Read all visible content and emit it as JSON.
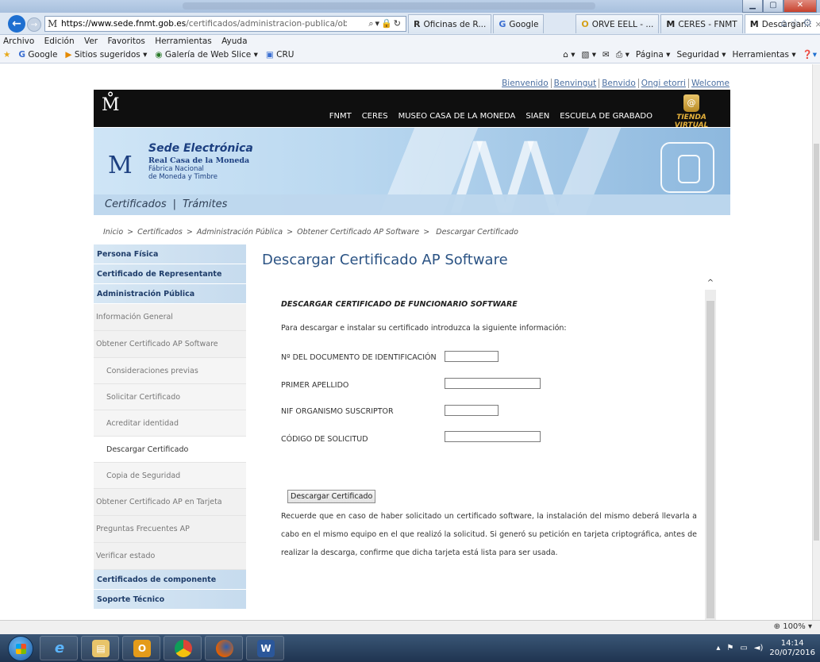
{
  "browser": {
    "address": {
      "url_host": "https://www.sede.fnmt.gob.es",
      "url_path": "/certificados/administracion-publica/obtener-certificado-",
      "favicon": "fnmt-crest-icon"
    },
    "tabs": [
      {
        "label": "Oficinas de R...",
        "icon": "R"
      },
      {
        "label": "Google",
        "icon": "G"
      },
      {
        "label": "ORVE EELL - ...",
        "icon": "O"
      },
      {
        "label": "CERES - FNMT",
        "icon": "M"
      },
      {
        "label": "Descargar...",
        "icon": "M",
        "active": true
      }
    ],
    "tab_close": "×",
    "menu": [
      "Archivo",
      "Edición",
      "Ver",
      "Favoritos",
      "Herramientas",
      "Ayuda"
    ],
    "favorites": [
      "Google",
      "Sitios sugeridos ▾",
      "Galería de Web Slice ▾",
      "CRU"
    ],
    "toolbar_right": [
      "Página ▾",
      "Seguridad ▾",
      "Herramientas ▾"
    ],
    "zoom": "100%"
  },
  "site": {
    "languages": [
      "Bienvenido",
      "Benvingut",
      "Benvido",
      "Ongi etorri",
      "Welcome"
    ],
    "crest": "M̊",
    "topnav": [
      "FNMT",
      "CERES",
      "MUSEO CASA DE LA MONEDA",
      "SIAEN",
      "ESCUELA DE GRABADO"
    ],
    "shop_label": "TIENDA VIRTUAL",
    "brand": {
      "title": "Sede Electrónica",
      "line1": "Real Casa de la Moneda",
      "line2": "Fábrica Nacional",
      "line3": "de Moneda y Timbre"
    },
    "subnav": [
      "Certificados",
      "Trámites"
    ],
    "breadcrumb": [
      "Inicio",
      "Certificados",
      "Administración Pública",
      "Obtener Certificado AP Software",
      "Descargar Certificado"
    ]
  },
  "sidebar": {
    "items": [
      {
        "label": "Persona Física",
        "kind": "cat"
      },
      {
        "label": "Certificado de Representante",
        "kind": "cat"
      },
      {
        "label": "Administración Pública",
        "kind": "cat"
      },
      {
        "label": "Información General",
        "kind": "sub"
      },
      {
        "label": "Obtener Certificado AP Software",
        "kind": "sub"
      },
      {
        "label": "Consideraciones previas",
        "kind": "sub2"
      },
      {
        "label": "Solicitar Certificado",
        "kind": "sub2"
      },
      {
        "label": "Acreditar identidad",
        "kind": "sub2"
      },
      {
        "label": "Descargar Certificado",
        "kind": "sub2",
        "current": true
      },
      {
        "label": "Copia de Seguridad",
        "kind": "sub2"
      },
      {
        "label": "Obtener Certificado AP en Tarjeta",
        "kind": "sub"
      },
      {
        "label": "Preguntas Frecuentes AP",
        "kind": "sub"
      },
      {
        "label": "Verificar estado",
        "kind": "sub"
      },
      {
        "label": "Certificados de componente",
        "kind": "cat"
      },
      {
        "label": "Soporte Técnico",
        "kind": "cat"
      }
    ]
  },
  "main": {
    "title": "Descargar Certificado AP Software",
    "heading": "DESCARGAR CERTIFICADO DE FUNCIONARIO SOFTWARE",
    "intro": "Para descargar e instalar su certificado introduzca la siguiente información:",
    "fields": {
      "doc_label": "Nº DEL DOCUMENTO DE IDENTIFICACIÓN",
      "doc_value": "",
      "surname_label": "PRIMER APELLIDO",
      "surname_value": "",
      "nif_label": "NIF ORGANISMO SUSCRIPTOR",
      "nif_value": "",
      "code_label": "CÓDIGO DE SOLICITUD",
      "code_value": ""
    },
    "button": "Descargar Certificado",
    "notice": "Recuerde que en caso de haber solicitado un certificado software, la instalación del mismo deberá llevarla a cabo en el mismo equipo en el que realizó la solicitud. Si generó su petición en tarjeta criptográfica, antes de realizar la descarga, confirme que dicha tarjeta está lista para ser usada."
  },
  "taskbar": {
    "apps": [
      "internet-explorer-icon",
      "file-explorer-icon",
      "outlook-icon",
      "chrome-icon",
      "firefox-icon",
      "word-icon"
    ],
    "time": "14:14",
    "date": "20/07/2016"
  },
  "colors": {
    "title_blue": "#2b5384",
    "sidebar_cat": "#c6dbee",
    "topnav_bg": "#0f0f0f"
  }
}
